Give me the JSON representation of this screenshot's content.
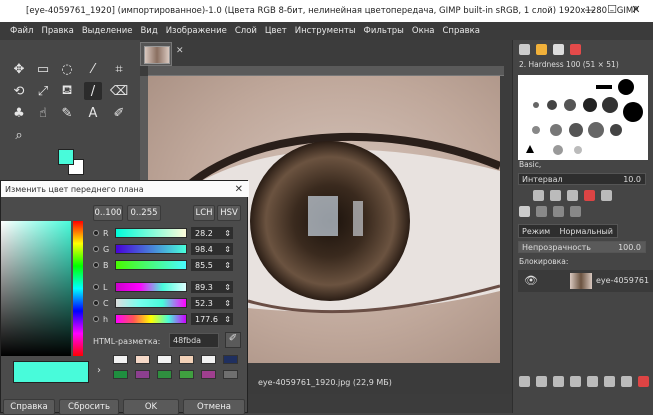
{
  "title_bar": {
    "text": "[eye-4059761_1920] (импортированное)-1.0 (Цвета RGB 8-бит, нелинейная цветопередача, GIMP built-in sRGB, 1 слой) 1920x1280 – GIMP",
    "minimize": "—",
    "maximize": "☐",
    "close": "✕"
  },
  "menu": [
    "Файл",
    "Правка",
    "Выделение",
    "Вид",
    "Изображение",
    "Слой",
    "Цвет",
    "Инструменты",
    "Фильтры",
    "Окна",
    "Справка"
  ],
  "canvas": {
    "status_text": "eye-4059761_1920.jpg (22,9 МБ)",
    "tab_close": "✕"
  },
  "brushes": {
    "header": "2. Hardness 100 (51 × 51)",
    "preset": "Basic,",
    "spacing_label": "Интервал",
    "spacing_value": "10.0"
  },
  "layers": {
    "mode_label": "Режим",
    "mode_value": "Нормальный",
    "opacity_label": "Непрозрачность",
    "opacity_value": "100.0",
    "lock_label": "Блокировка:",
    "layer_name": "eye-4059761"
  },
  "color_dialog": {
    "title": "Изменить цвет переднего плана",
    "range_a": "0..100",
    "range_b": "0..255",
    "mode_lch": "LCH",
    "mode_hsv": "HSV",
    "sliders": [
      {
        "label": "R",
        "value": "28.2"
      },
      {
        "label": "G",
        "value": "98.4"
      },
      {
        "label": "B",
        "value": "85.5"
      },
      {
        "label": "L",
        "value": "89.3"
      },
      {
        "label": "C",
        "value": "52.3"
      },
      {
        "label": "h",
        "value": "177.6"
      }
    ],
    "html_label": "HTML-разметка:",
    "html_value": "48fbda",
    "buttons": {
      "help": "Справка",
      "reset": "Сбросить",
      "ok": "OK",
      "cancel": "Отмена"
    },
    "history_colors": [
      "#f2f2f2",
      "#f5d9c8",
      "#f2f2f2",
      "#f3d2b8",
      "#f2f2f2",
      "#1f2f5f",
      "#1f8f3f",
      "#8c3f8f",
      "#2f8f3f",
      "#3f9f3f",
      "#9f3f8f",
      "#6f6f6f"
    ],
    "current_color": "#48fbda"
  },
  "colors": {
    "fg": "#48fbda",
    "bg": "#ffffff",
    "accent_title": "#ffffff"
  }
}
